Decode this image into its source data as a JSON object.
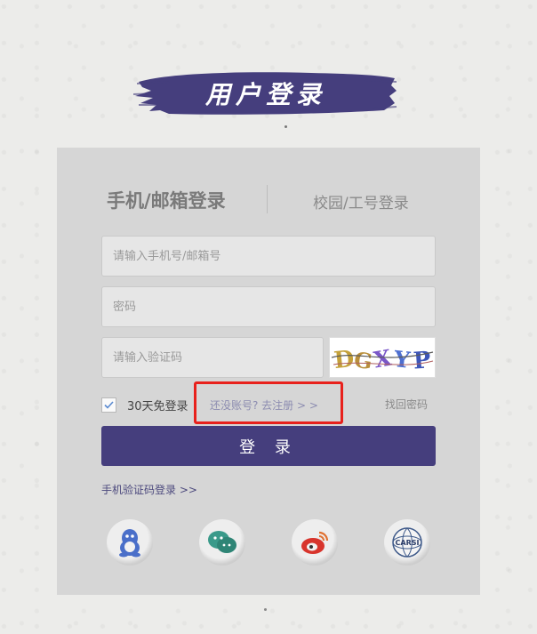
{
  "banner": {
    "title": "用户登录"
  },
  "tabs": {
    "active": "手机/邮箱登录",
    "inactive": "校园/工号登录"
  },
  "form": {
    "account_placeholder": "请输入手机号/邮箱号",
    "password_placeholder": "密码",
    "captcha_placeholder": "请输入验证码",
    "captcha_text": "DGXYP",
    "remember_label": "30天免登录",
    "register_link": "还没账号? 去注册 > >",
    "forgot_link": "找回密码",
    "login_button": "登 录",
    "sms_login_link": "手机验证码登录 >>"
  },
  "colors": {
    "accent": "#453e7d",
    "highlight_box": "#e8211c"
  },
  "socials": [
    {
      "icon": "qq-icon"
    },
    {
      "icon": "wechat-icon"
    },
    {
      "icon": "weibo-icon"
    },
    {
      "icon": "carsi-icon",
      "label": "CARSI"
    }
  ]
}
